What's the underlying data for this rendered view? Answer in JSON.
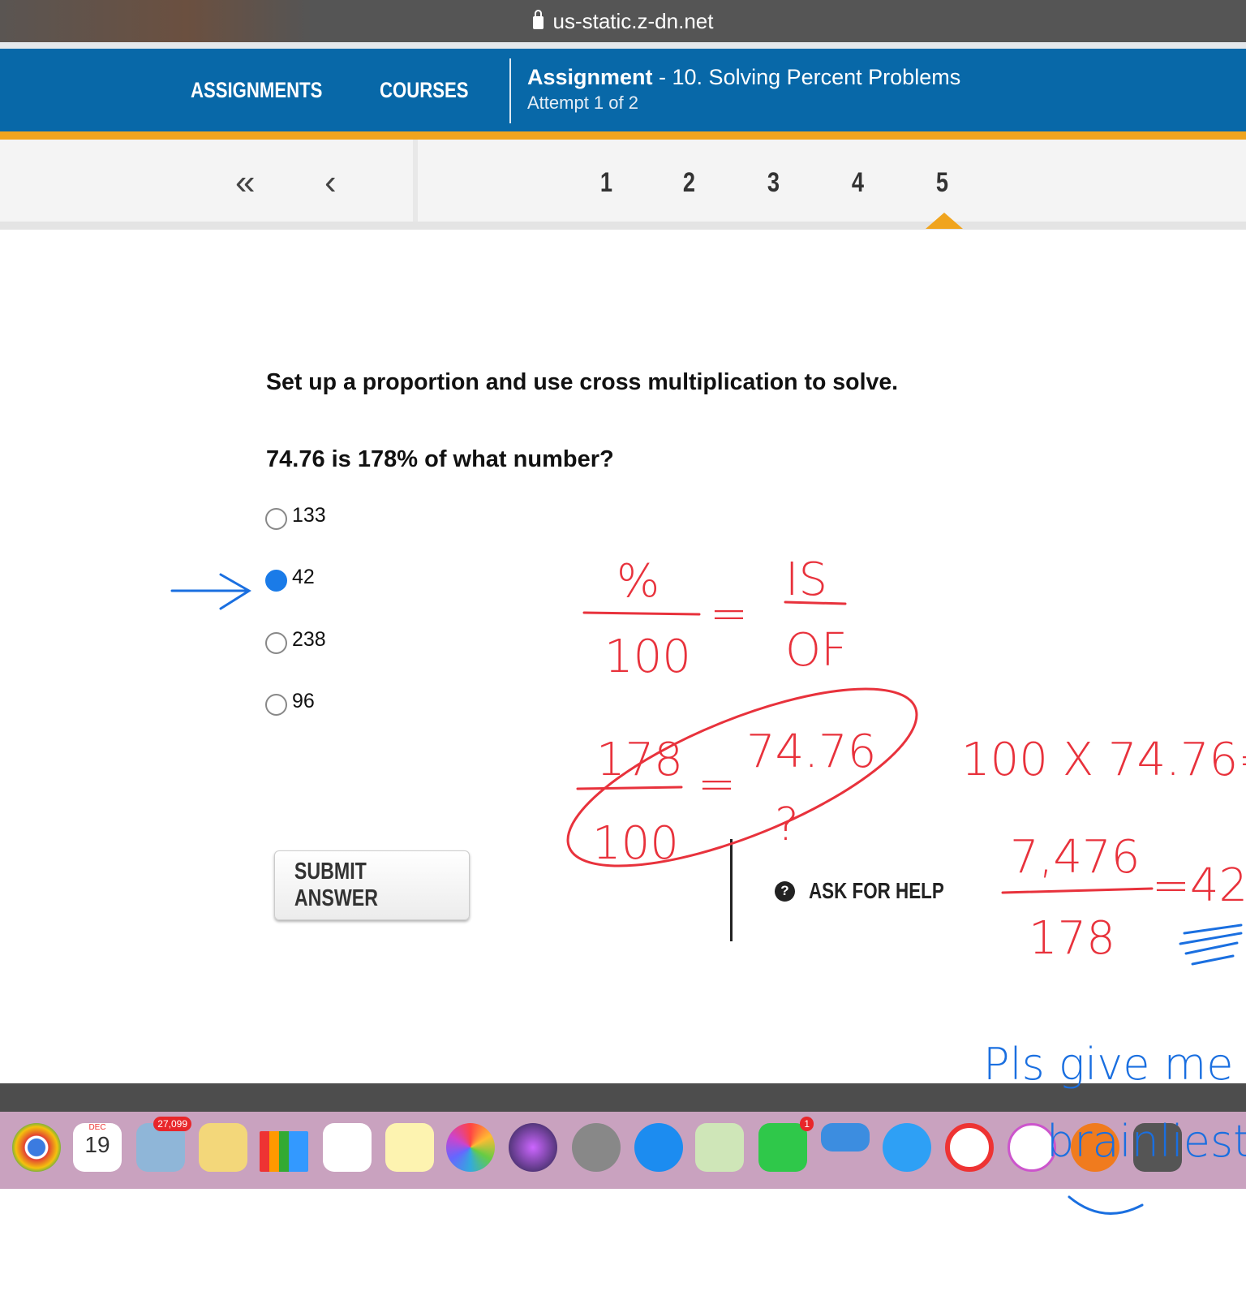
{
  "browser": {
    "url": "us-static.z-dn.net"
  },
  "header": {
    "nav": [
      "ASSIGNMENTS",
      "COURSES"
    ],
    "title_bold": "Assignment",
    "title_rest": " - 10. Solving Percent Problems",
    "subtitle": "Attempt 1 of 2"
  },
  "question_nav": {
    "first_icon": "«",
    "prev_icon": "‹",
    "numbers": [
      "1",
      "2",
      "3",
      "4",
      "5"
    ],
    "current": "5"
  },
  "question": {
    "prompt": "Set up a proportion and use cross multiplication to solve.",
    "text": "74.76 is 178% of what number?",
    "options": [
      {
        "label": "133",
        "selected": false
      },
      {
        "label": "42",
        "selected": true
      },
      {
        "label": "238",
        "selected": false
      },
      {
        "label": "96",
        "selected": false
      }
    ]
  },
  "actions": {
    "submit": "SUBMIT ANSWER",
    "help": "ASK FOR HELP",
    "help_icon": "?"
  },
  "dock": {
    "calendar_month": "DEC",
    "calendar_day": "19",
    "mail_badge": "27,099",
    "facetime_badge": "1"
  },
  "annotations": {
    "pct": "%",
    "hundred": "100",
    "is": "IS",
    "of": "OF",
    "eq": "=",
    "n178": "178",
    "n100": "100",
    "v7476": "74.76",
    "unknown": "?",
    "calc1": "100 X 74.76=",
    "num": "7,476",
    "den": "178",
    "result": "=42",
    "note1": "Pls give me",
    "note2": "brainliest"
  },
  "colors": {
    "header": "#0868a8",
    "accent": "#f0a41e",
    "ink_red": "#e8323c",
    "ink_blue": "#1a6fe0"
  }
}
